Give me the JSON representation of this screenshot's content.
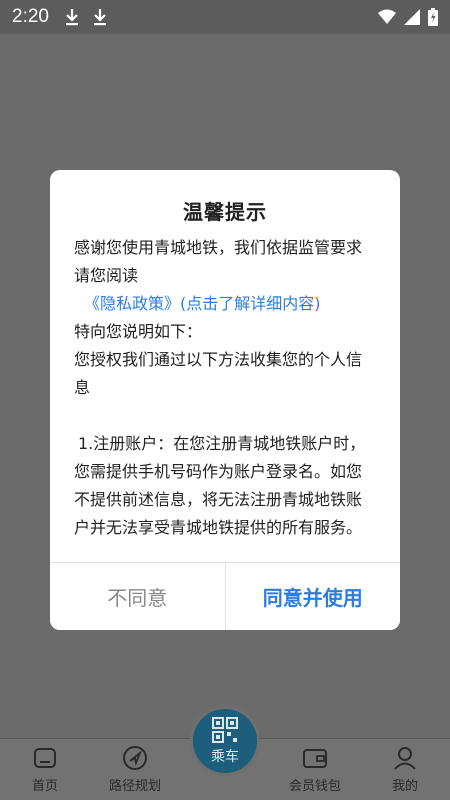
{
  "status_bar": {
    "time": "2:20"
  },
  "dialog": {
    "title": "温馨提示",
    "intro": "感谢您使用青城地铁，我们依据监管要求请您阅读",
    "privacy_link": "《隐私政策》(点击了解详细内容)",
    "explain": "特向您说明如下：",
    "collect": "您授权我们通过以下方法收集您的个人信息",
    "item1": "1.注册账户：在您注册青城地铁账户时，您需提供手机号码作为账户登录名。如您不提供前述信息，将无法注册青城地铁账户并无法享受青城地铁提供的所有服务。",
    "disagree_label": "不同意",
    "agree_label": "同意并使用"
  },
  "tabs": {
    "home": "首页",
    "route": "路径规划",
    "ride": "乘车",
    "wallet": "会员钱包",
    "mine": "我的"
  },
  "colors": {
    "accent": "#2a7de1",
    "ride_button": "#1c5e7c"
  }
}
